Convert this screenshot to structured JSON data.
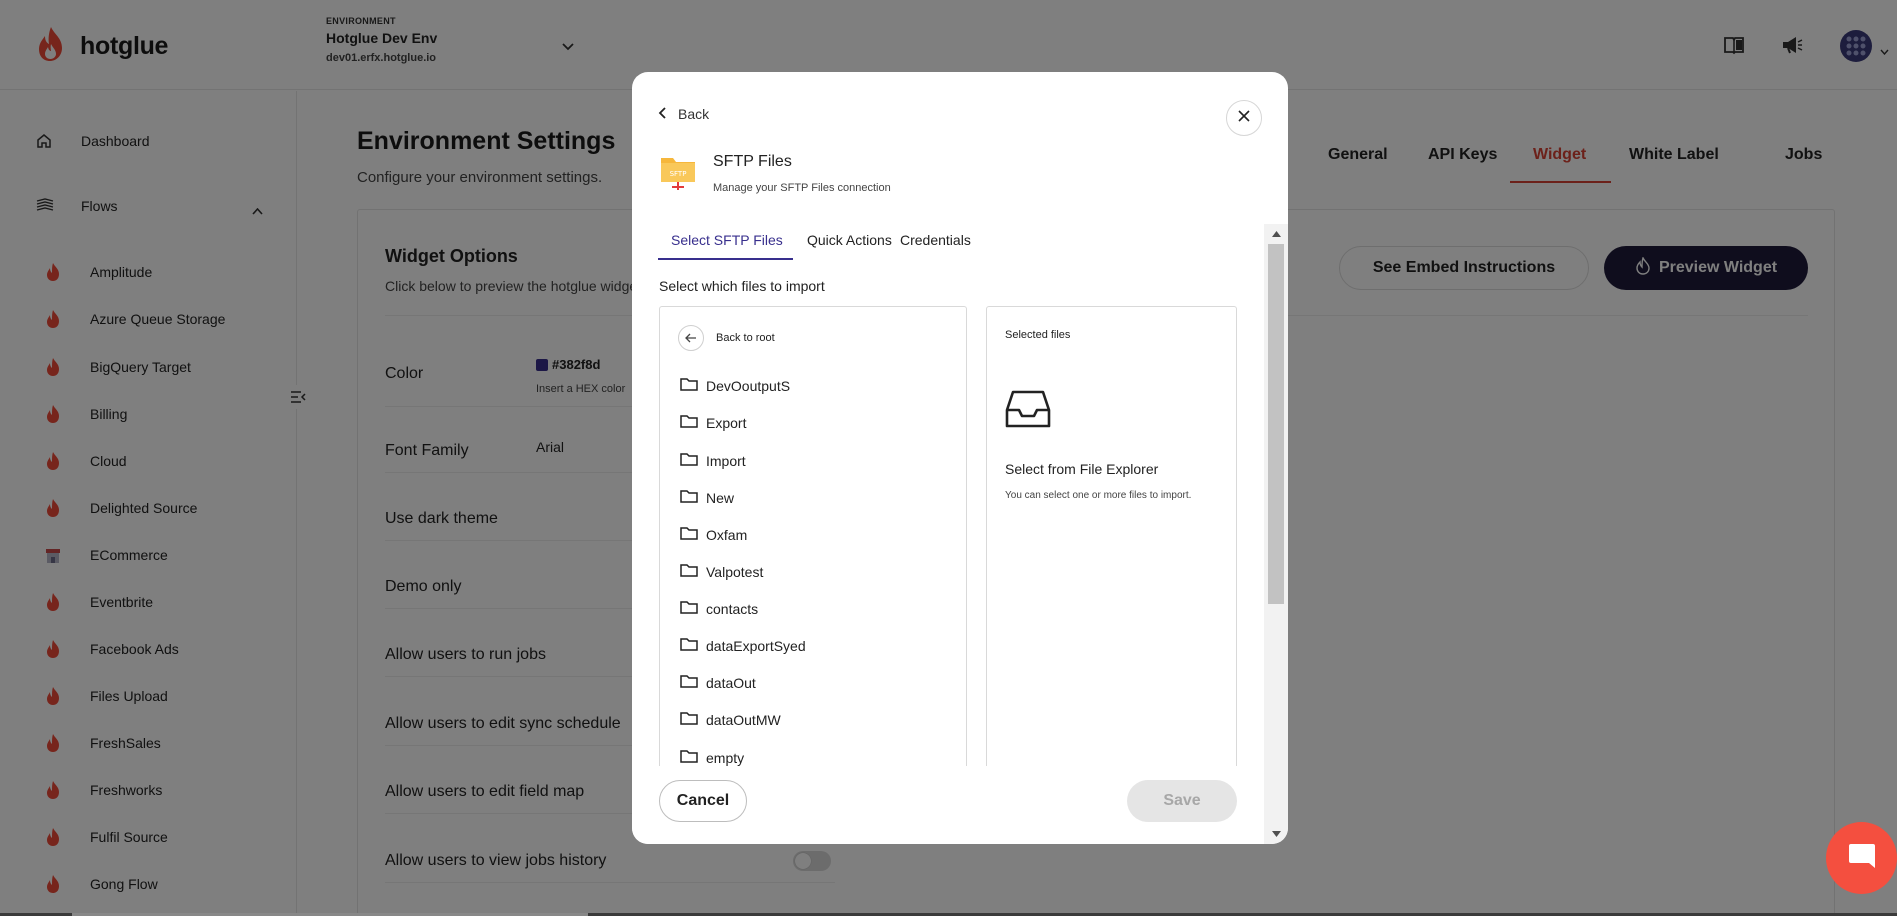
{
  "brand": {
    "name": "hotglue"
  },
  "environment": {
    "label": "ENVIRONMENT",
    "name": "Hotglue Dev Env",
    "host": "dev01.erfx.hotglue.io"
  },
  "sidebar": {
    "dashboard": "Dashboard",
    "flows": "Flows",
    "flow_items": [
      "Amplitude",
      "Azure Queue Storage",
      "BigQuery Target",
      "Billing",
      "Cloud",
      "Delighted Source",
      "ECommerce",
      "Eventbrite",
      "Facebook Ads",
      "Files Upload",
      "FreshSales",
      "Freshworks",
      "Fulfil Source",
      "Gong Flow"
    ]
  },
  "page": {
    "title": "Environment Settings",
    "subtitle": "Configure your environment settings.",
    "tabs": [
      "General",
      "API Keys",
      "Widget",
      "White Label",
      "Jobs"
    ],
    "active_tab": "Widget"
  },
  "widget_options": {
    "title": "Widget Options",
    "subtitle": "Click below to preview the hotglue widget",
    "embed_button": "See Embed Instructions",
    "preview_button": "Preview Widget",
    "color_label": "Color",
    "color_value": "#382f8d",
    "color_hint": "Insert a HEX color",
    "font_label": "Font Family",
    "font_value": "Arial",
    "options": [
      "Use dark theme",
      "Demo only",
      "Allow users to run jobs",
      "Allow users to edit sync schedule",
      "Allow users to edit field map",
      "Allow users to view jobs history"
    ]
  },
  "modal": {
    "back": "Back",
    "connector_title": "SFTP Files",
    "connector_subtitle": "Manage your SFTP Files connection",
    "connector_badge": "SFTP",
    "tabs": [
      "Select SFTP Files",
      "Quick Actions",
      "Credentials"
    ],
    "active_tab": "Select SFTP Files",
    "select_label": "Select which files to import",
    "back_to_root": "Back to root",
    "folders": [
      "DevOoutputS",
      "Export",
      "Import",
      "New",
      "Oxfam",
      "Valpotest",
      "contacts",
      "dataExportSyed",
      "dataOut",
      "dataOutMW",
      "empty"
    ],
    "selected_title": "Selected files",
    "selected_heading": "Select from File Explorer",
    "selected_desc": "You can select one or more files to import.",
    "cancel": "Cancel",
    "save": "Save"
  },
  "colors": {
    "accent": "#382f8d",
    "brand_red": "#d94235",
    "preview_button": "#1e1b3a",
    "chat": "#f44f3f"
  }
}
